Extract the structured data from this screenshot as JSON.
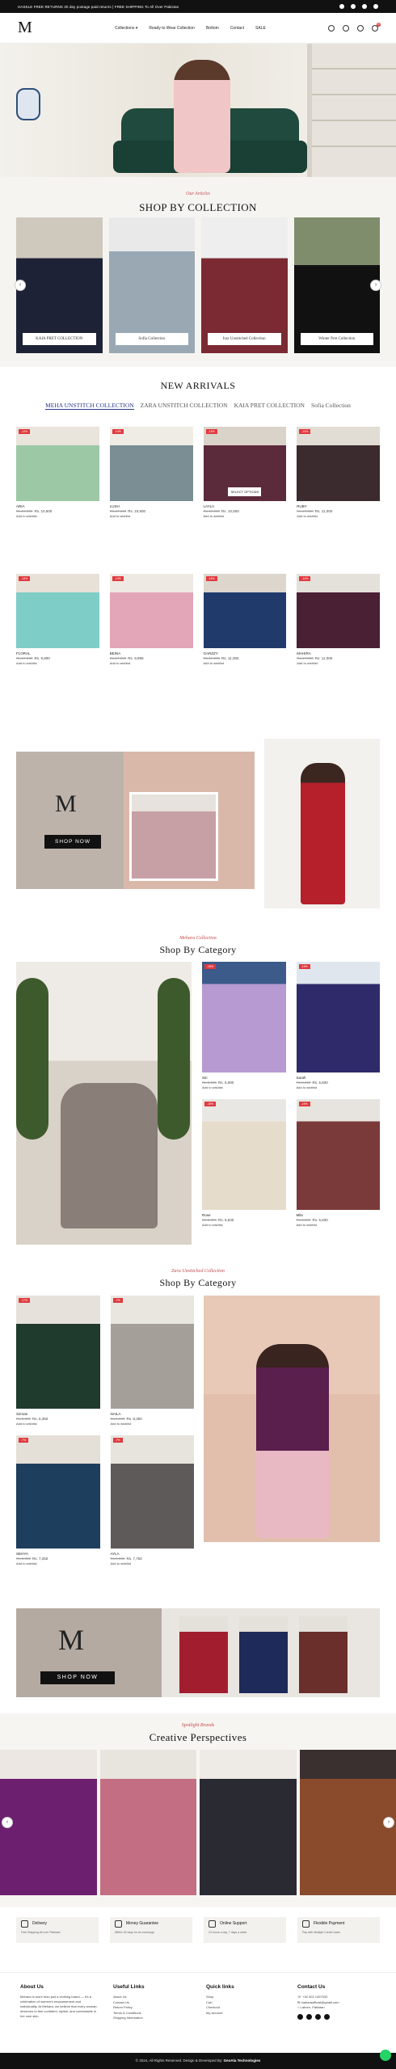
{
  "topbar": {
    "message": "HASSLE FREE RETURNS 30 day postage paid returns  |  FREE SHIPPING To All Over Pakistan",
    "social": [
      "facebook-icon",
      "instagram-icon",
      "tiktok-icon",
      "youtube-icon"
    ]
  },
  "header": {
    "logo": "M",
    "nav": [
      "Collections ▾",
      "Ready to Wear Collection",
      "Bottom",
      "Contact",
      "SALE"
    ],
    "cart_count": "0"
  },
  "collection": {
    "script": "Our Articles",
    "title": "SHOP BY COLLECTION",
    "cards": [
      "KAIA PRET COLLECTION",
      "Sofia Collection",
      "Iraz Unstitched Collection",
      "Winter Pret Collection"
    ]
  },
  "arrivals": {
    "title": "NEW ARRIVALS",
    "tabs": [
      "MEHA UNSTITCH COLLECTION",
      "ZARA UNSTITCH COLLECTION",
      "KAIA PRET COLLECTION",
      "Sofia Collection"
    ],
    "wishlist_label": "Add to wishlist",
    "select_options": "SELECT OPTIONS",
    "products": [
      {
        "name": "ARIA",
        "old": "Rs.17,990",
        "price": "Rs. 10,500",
        "badge": "-14%"
      },
      {
        "name": "LUSH",
        "old": "Rs.17,990",
        "price": "Rs. 10,500",
        "badge": "-14%"
      },
      {
        "name": "LAYLA",
        "old": "Rs.17,990",
        "price": "Rs. 10,500",
        "badge": "-14%"
      },
      {
        "name": "RUBY",
        "old": "Rs.17,990",
        "price": "Rs. 11,000",
        "badge": "-14%"
      },
      {
        "name": "FLORAL",
        "old": "Rs.17,990",
        "price": "Rs. 9,800",
        "badge": "-14%"
      },
      {
        "name": "BEINA",
        "old": "Rs.17,990",
        "price": "Rs. 9,999",
        "badge": "-14%"
      },
      {
        "name": "GARZZY",
        "old": "Rs.17,990",
        "price": "Rs. 11,000",
        "badge": "-14%"
      },
      {
        "name": "MAHIRA",
        "old": "Rs.17,990",
        "price": "Rs. 11,000",
        "badge": "-14%"
      }
    ]
  },
  "banner": {
    "logo": "M",
    "cta": "SHOP NOW"
  },
  "category1": {
    "script": "Mehara Collection",
    "title": "Shop By Category",
    "products": [
      {
        "name": "Siri",
        "old": "Rs.8,990",
        "price": "Rs. 5,990",
        "badge": "-15%"
      },
      {
        "name": "Sarah",
        "old": "Rs.8,990",
        "price": "Rs. 5,830",
        "badge": "-15%"
      },
      {
        "name": "Rose",
        "old": "Rs.8,990",
        "price": "Rs. 5,530",
        "badge": "-15%"
      },
      {
        "name": "Mila",
        "old": "Rs.8,990",
        "price": "Rs. 5,830",
        "badge": "-15%"
      }
    ]
  },
  "category2": {
    "script": "Zara Unstitched Collection",
    "title": "Shop By Category",
    "products": [
      {
        "name": "Simran",
        "old": "Rs.9,990",
        "price": "Rs. 6,350",
        "badge": "-17%"
      },
      {
        "name": "NAILA",
        "old": "Rs.9,990",
        "price": "Rs. 8,350",
        "badge": "-7%"
      },
      {
        "name": "SEHYA",
        "old": "Rs.9,990",
        "price": "Rs. 7,250",
        "badge": "-7%"
      },
      {
        "name": "AYLA",
        "old": "Rs.9,990",
        "price": "Rs. 7,750",
        "badge": "-7%"
      }
    ]
  },
  "banner2": {
    "logo": "M",
    "cta": "SHOP NOW"
  },
  "creative": {
    "script": "Spotlight Brands",
    "title": "Creative Perspectives"
  },
  "features": [
    {
      "title": "Delivery",
      "desc": "Free Shipping All over Pakistan"
    },
    {
      "title": "Money Guarantee",
      "desc": "Within 30 days for an exchange"
    },
    {
      "title": "Online Support",
      "desc": "24 hours a day, 7 days a week"
    },
    {
      "title": "Flexible Payment",
      "desc": "Pay with Multiple Credit Cards"
    }
  ],
  "footer": {
    "about": {
      "title": "About Us",
      "text": "Mehara is more than just a clothing brand — it's a celebration of women's empowerment and individuality. At Mehara, we believe that every woman deserves to feel confident, stylish, and comfortable in her own skin."
    },
    "useful": {
      "title": "Useful Links",
      "links": [
        "About Us",
        "Contact Us",
        "Return Policy",
        "Terms & Conditions",
        "Shipping Information"
      ]
    },
    "quick": {
      "title": "Quick links",
      "links": [
        "Shop",
        "Cart",
        "Checkout",
        "My account"
      ]
    },
    "contact": {
      "title": "Contact Us",
      "lines": [
        "+92 302 1497030",
        "maharaofficial@gmail.com",
        "Lahore, Pakistan"
      ]
    },
    "copyright": "© 2024, All Rights Reserved. Design & Developed By:",
    "developer": "GeoAla Technologies"
  },
  "colors": {
    "accent": "#c24a4a",
    "badge": "#e0393e",
    "dark": "#111111",
    "tab_active": "#2b3a8a"
  }
}
